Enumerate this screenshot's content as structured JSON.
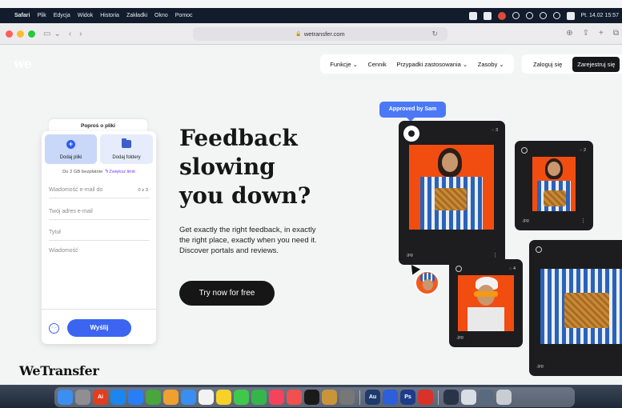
{
  "menubar": {
    "items": [
      "Safari",
      "Plik",
      "Edycja",
      "Widok",
      "Historia",
      "Zakładki",
      "Okno",
      "Pomoc"
    ],
    "clock": "Pt. 14.02  15:57"
  },
  "browser": {
    "url": "wetransfer.com"
  },
  "nav": {
    "logo": "we",
    "items": [
      "Funkcje ⌄",
      "Cennik",
      "Przypadki zastosowania ⌄",
      "Zasoby ⌄"
    ],
    "login": "Zaloguj się",
    "register": "Zarejestruj się"
  },
  "widget": {
    "tab_request": "Poproś o pliki",
    "add_files": "Dodaj pliki",
    "add_folders": "Dodaj foldery",
    "limit_text": "Do 2 GB bezpłatnie",
    "limit_upgrade": "Zwiększ limit",
    "email_to_placeholder": "Wiadomość e-mail do",
    "email_count": "0 z 3",
    "your_email_placeholder": "Twój adres e-mail",
    "title_placeholder": "Tytuł",
    "message_placeholder": "Wiadomość",
    "more": "···",
    "send": "Wyślij"
  },
  "hero": {
    "headline_1": "Feedback",
    "headline_2": "slowing",
    "headline_3": "you down?",
    "subtitle": "Get exactly the right feedback, in exactly the right place, exactly when you need it. Discover portals and reviews.",
    "cta": "Try now for free"
  },
  "brand": "WeTransfer",
  "portals": {
    "badge": "Approved by Sam",
    "card1": {
      "comments": "3",
      "ext": ".jpg"
    },
    "card2": {
      "comments": "2",
      "ext": ".jpg"
    },
    "card3": {
      "comments": "4",
      "ext": ".jpg"
    },
    "card4": {
      "ext": ".jpg"
    }
  },
  "colors": {
    "accent": "#3b65f0",
    "badge": "#4b79f6",
    "photo_bg": "#f24d11",
    "dark_card": "#1d1d1f"
  }
}
